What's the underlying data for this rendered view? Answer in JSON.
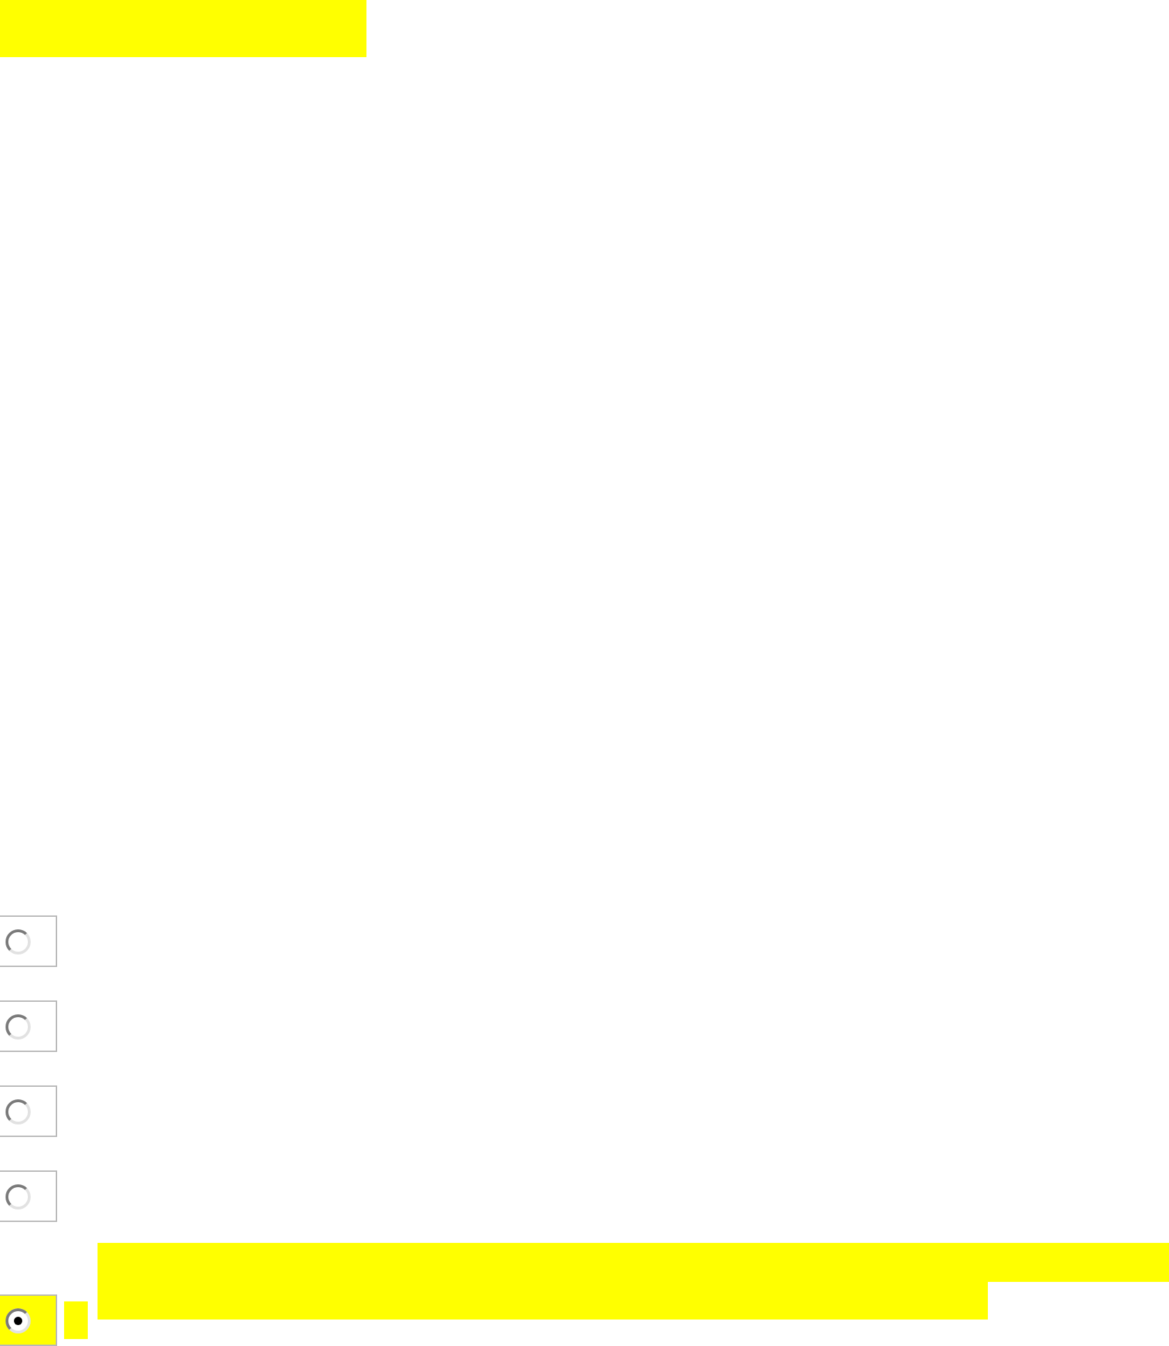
{
  "header_bar": {
    "highlighted": true
  },
  "options": [
    {
      "selected": false,
      "highlighted": false
    },
    {
      "selected": false,
      "highlighted": false
    },
    {
      "selected": false,
      "highlighted": false
    },
    {
      "selected": false,
      "highlighted": false
    },
    {
      "selected": true,
      "highlighted": true
    }
  ]
}
